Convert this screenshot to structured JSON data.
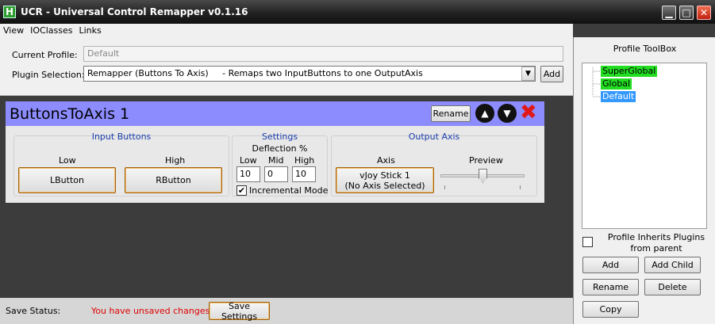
{
  "window": {
    "app_icon": "H",
    "title": "UCR - Universal Control Remapper v0.1.16",
    "minimize_glyph": "▁",
    "maximize_glyph": "□",
    "close_glyph": "✕"
  },
  "menu": [
    "View",
    "IOClasses",
    "Links"
  ],
  "profile": {
    "current_profile_label": "Current Profile:",
    "current_profile_value": "Default",
    "plugin_selection_label": "Plugin Selection:",
    "plugin_selection_value": "Remapper (Buttons To Axis)     - Remaps two InputButtons to one OutputAxis",
    "add_label": "Add"
  },
  "plugin": {
    "title": "ButtonsToAxis 1",
    "rename_label": "Rename",
    "up_glyph": "▲",
    "down_glyph": "▼",
    "delete_glyph": "✖",
    "accent_color": "#8c8cff",
    "input_buttons": {
      "title": "Input Buttons",
      "low_label": "Low",
      "high_label": "High",
      "low_button": "LButton",
      "high_button": "RButton"
    },
    "settings": {
      "title": "Settings",
      "deflection_label": "Deflection %",
      "low_label": "Low",
      "mid_label": "Mid",
      "high_label": "High",
      "low_value": "10",
      "mid_value": "0",
      "high_value": "10",
      "incremental_checked": "✔",
      "incremental_label": "Incremental Mode"
    },
    "output_axis": {
      "title": "Output Axis",
      "axis_label": "Axis",
      "preview_label": "Preview",
      "axis_button_line1": "vJoy Stick 1",
      "axis_button_line2": "(No Axis Selected)",
      "preview_fraction": 0.5
    }
  },
  "status": {
    "label": "Save Status:",
    "message": "You have unsaved changes",
    "message_color": "#e00000",
    "save_button": "Save Settings"
  },
  "toolbox": {
    "title": "Profile ToolBox",
    "tree": [
      {
        "name": "SuperGlobal",
        "color": "#22dd22"
      },
      {
        "name": "Global",
        "color": "#22dd22"
      },
      {
        "name": "Default",
        "color": "#3399ff"
      }
    ],
    "inherit_label_line1": "Profile Inherits Plugins",
    "inherit_label_line2": "from parent",
    "buttons": {
      "add": "Add",
      "add_child": "Add Child",
      "rename": "Rename",
      "delete": "Delete",
      "copy": "Copy"
    }
  }
}
